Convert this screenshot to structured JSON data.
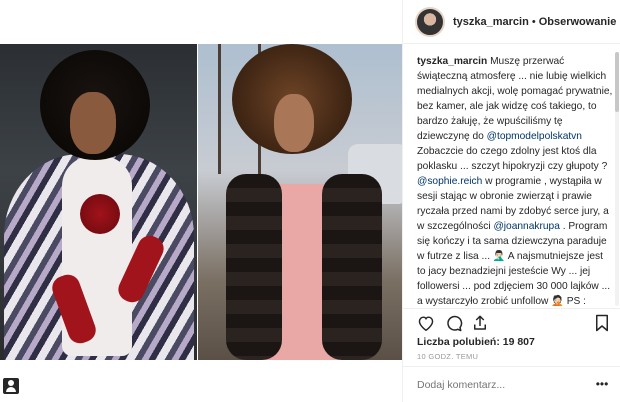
{
  "header": {
    "username": "tyszka_marcin",
    "separator": "•",
    "follow_label": "Obserwowanie"
  },
  "caption": {
    "author": "tyszka_marcin",
    "part1": " Muszę przerwać świąteczną atmosferę ... nie lubię wielkich medialnych akcji, wolę pomagać prywatnie, bez kamer, ale jak widzę coś takiego, to bardzo żałuję, że wpuściliśmy tę dziewczynę do ",
    "mention1": "@topmodelpolskatvn",
    "part2": " Zobaczcie do czego zdolny jest ktoś dla poklasku ... szczyt hipokryzji czy głupoty ? ",
    "mention2": "@sophie.reich",
    "part3": " w programie , wystąpiła w sesji stając w obronie zwierząt i prawie ryczała przed nami by zdobyć serce jury, a w szczególności ",
    "mention3": "@joannakrupa",
    "part4": " . Program się kończy i ta sama dziewczyna paraduje w futrze z lisa ... 🤦🏻‍♂️ A najsmutniejsze jest to jacy beznadziejni jesteście Wy ... jej followersi ... pod zdjęciem 30 000 lajków ... a wystarczyło zrobić unfollow 🤦🏻 PS : Sophie po moim poście i paru dniach od wrzucenia zdjęcia zedytowała komentarz i przypomniała sobie, że futro lubi ..."
  },
  "stats": {
    "likes_label": "Liczba polubień: 19 807",
    "time_ago": "10 GODZ. TEMU"
  },
  "comment": {
    "placeholder": "Dodaj komentarz...",
    "more_label": "•••"
  },
  "icons": {
    "like": "heart-icon",
    "comment": "comment-icon",
    "share": "share-icon",
    "save": "bookmark-icon",
    "profile": "profile-icon"
  }
}
